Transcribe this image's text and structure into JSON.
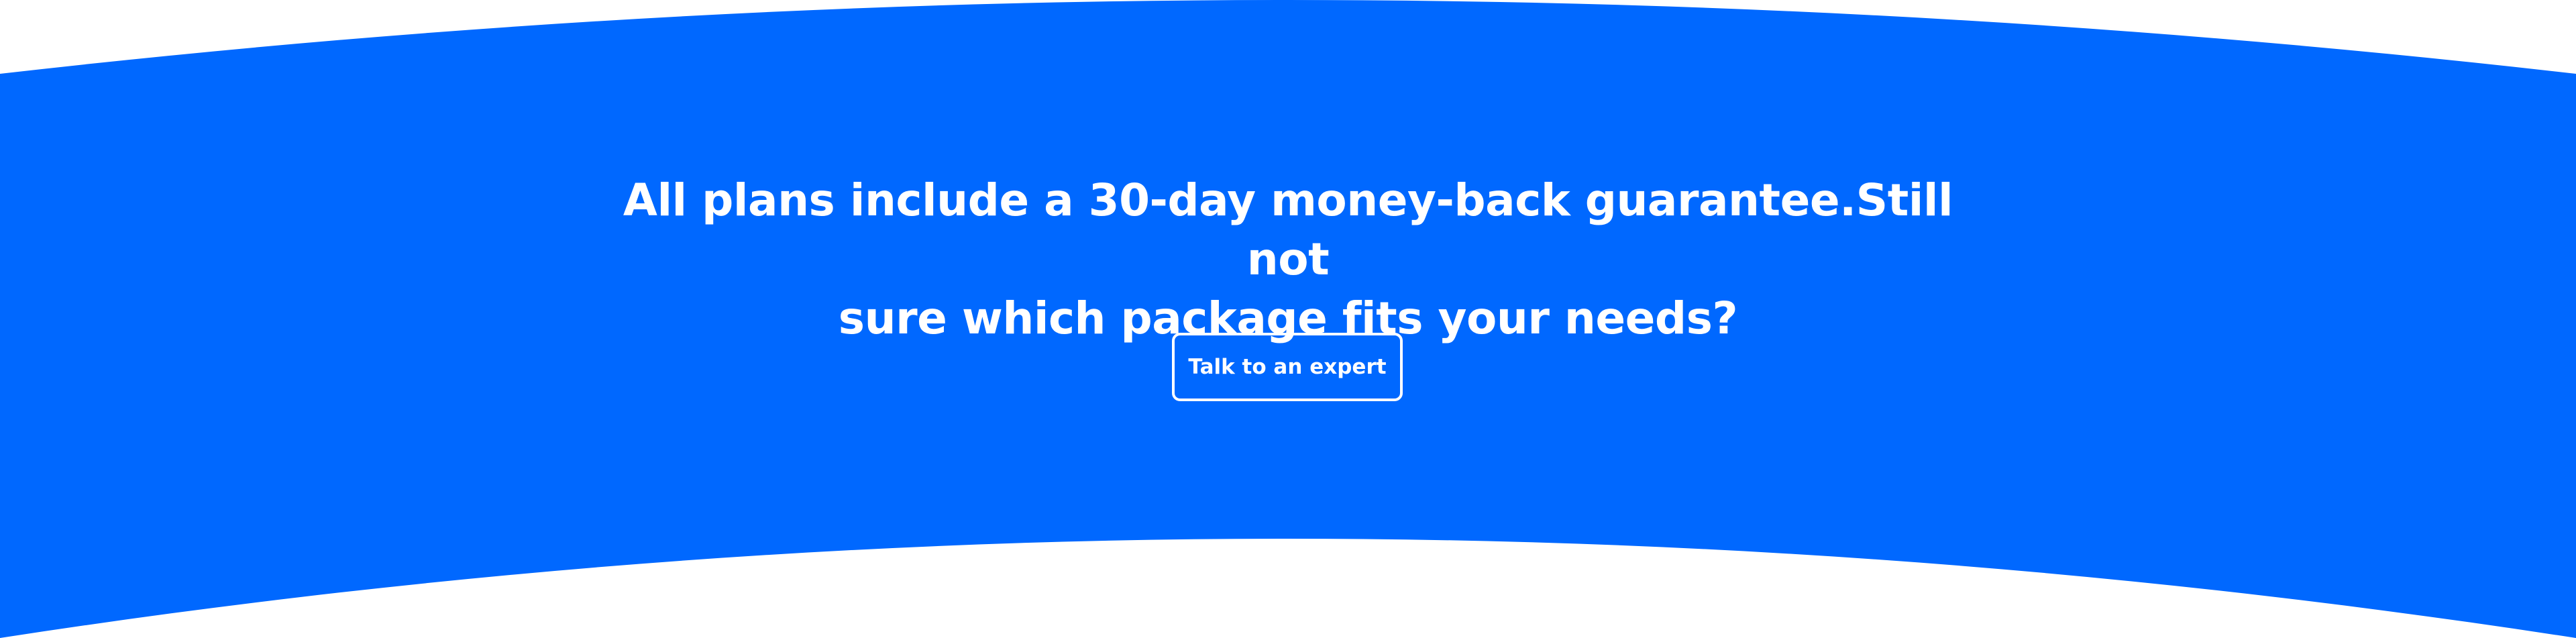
{
  "cta_section": {
    "headline_line1": "All plans include a 30-day money-back guarantee.Still not",
    "headline_line2": "sure which package fits your needs?",
    "button_label": "Talk to an expert"
  },
  "colors": {
    "band": "#0068FF",
    "text": "#FFFFFF",
    "background": "#FFFFFF"
  }
}
